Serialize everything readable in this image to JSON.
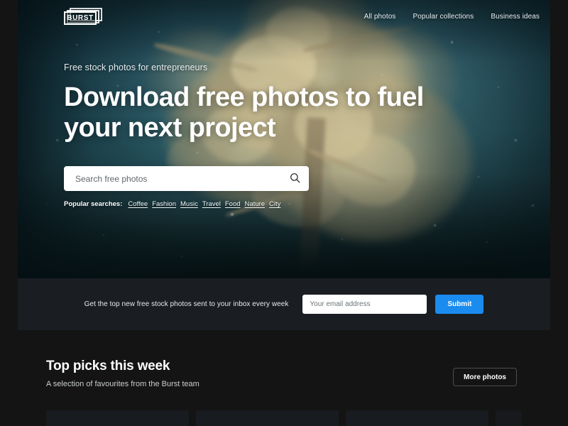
{
  "brand": {
    "logo_text": "BURST"
  },
  "nav": {
    "links": [
      {
        "label": "All photos"
      },
      {
        "label": "Popular collections"
      },
      {
        "label": "Business ideas"
      }
    ]
  },
  "hero": {
    "eyebrow": "Free stock photos for entrepreneurs",
    "headline": "Download free photos to fuel your next project",
    "search": {
      "placeholder": "Search free photos",
      "value": "",
      "icon": "search-icon"
    },
    "popular": {
      "label": "Popular searches:",
      "tags": [
        {
          "label": "Coffee"
        },
        {
          "label": "Fashion"
        },
        {
          "label": "Music"
        },
        {
          "label": "Travel"
        },
        {
          "label": "Food"
        },
        {
          "label": "Nature"
        },
        {
          "label": "City"
        }
      ]
    }
  },
  "newsletter": {
    "text": "Get the top new free stock photos sent to your inbox every week",
    "email_placeholder": "Your email address",
    "email_value": "",
    "submit_label": "Submit",
    "accent_color": "#1a8cf0"
  },
  "top_picks": {
    "title": "Top picks this week",
    "subtitle": "A selection of favourites from the Burst team",
    "more_label": "More photos",
    "cards": [
      {
        "id": "card-1"
      },
      {
        "id": "card-2"
      },
      {
        "id": "card-3"
      }
    ]
  }
}
